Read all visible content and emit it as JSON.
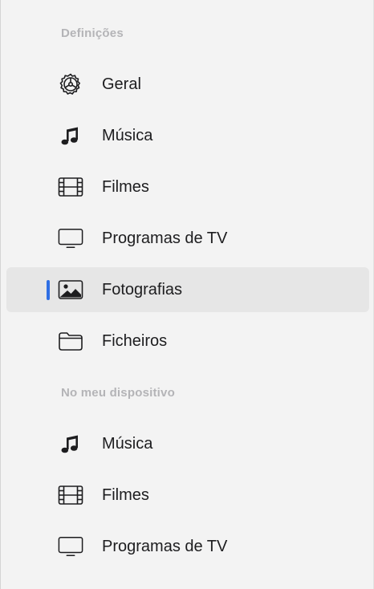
{
  "sections": [
    {
      "header": "Definições",
      "items": [
        {
          "label": "Geral",
          "icon": "gear-icon"
        },
        {
          "label": "Música",
          "icon": "music-note-icon"
        },
        {
          "label": "Filmes",
          "icon": "film-icon"
        },
        {
          "label": "Programas de TV",
          "icon": "tv-icon"
        },
        {
          "label": "Fotografias",
          "icon": "photo-icon",
          "selected": true
        },
        {
          "label": "Ficheiros",
          "icon": "folder-icon"
        }
      ]
    },
    {
      "header": "No meu dispositivo",
      "items": [
        {
          "label": "Música",
          "icon": "music-note-icon"
        },
        {
          "label": "Filmes",
          "icon": "film-icon"
        },
        {
          "label": "Programas de TV",
          "icon": "tv-icon"
        }
      ]
    }
  ],
  "colors": {
    "accent": "#2f6fe4",
    "selected_background": "#e6e6e6",
    "sidebar_background": "#f3f3f3",
    "header_text": "#b4b4b7"
  }
}
